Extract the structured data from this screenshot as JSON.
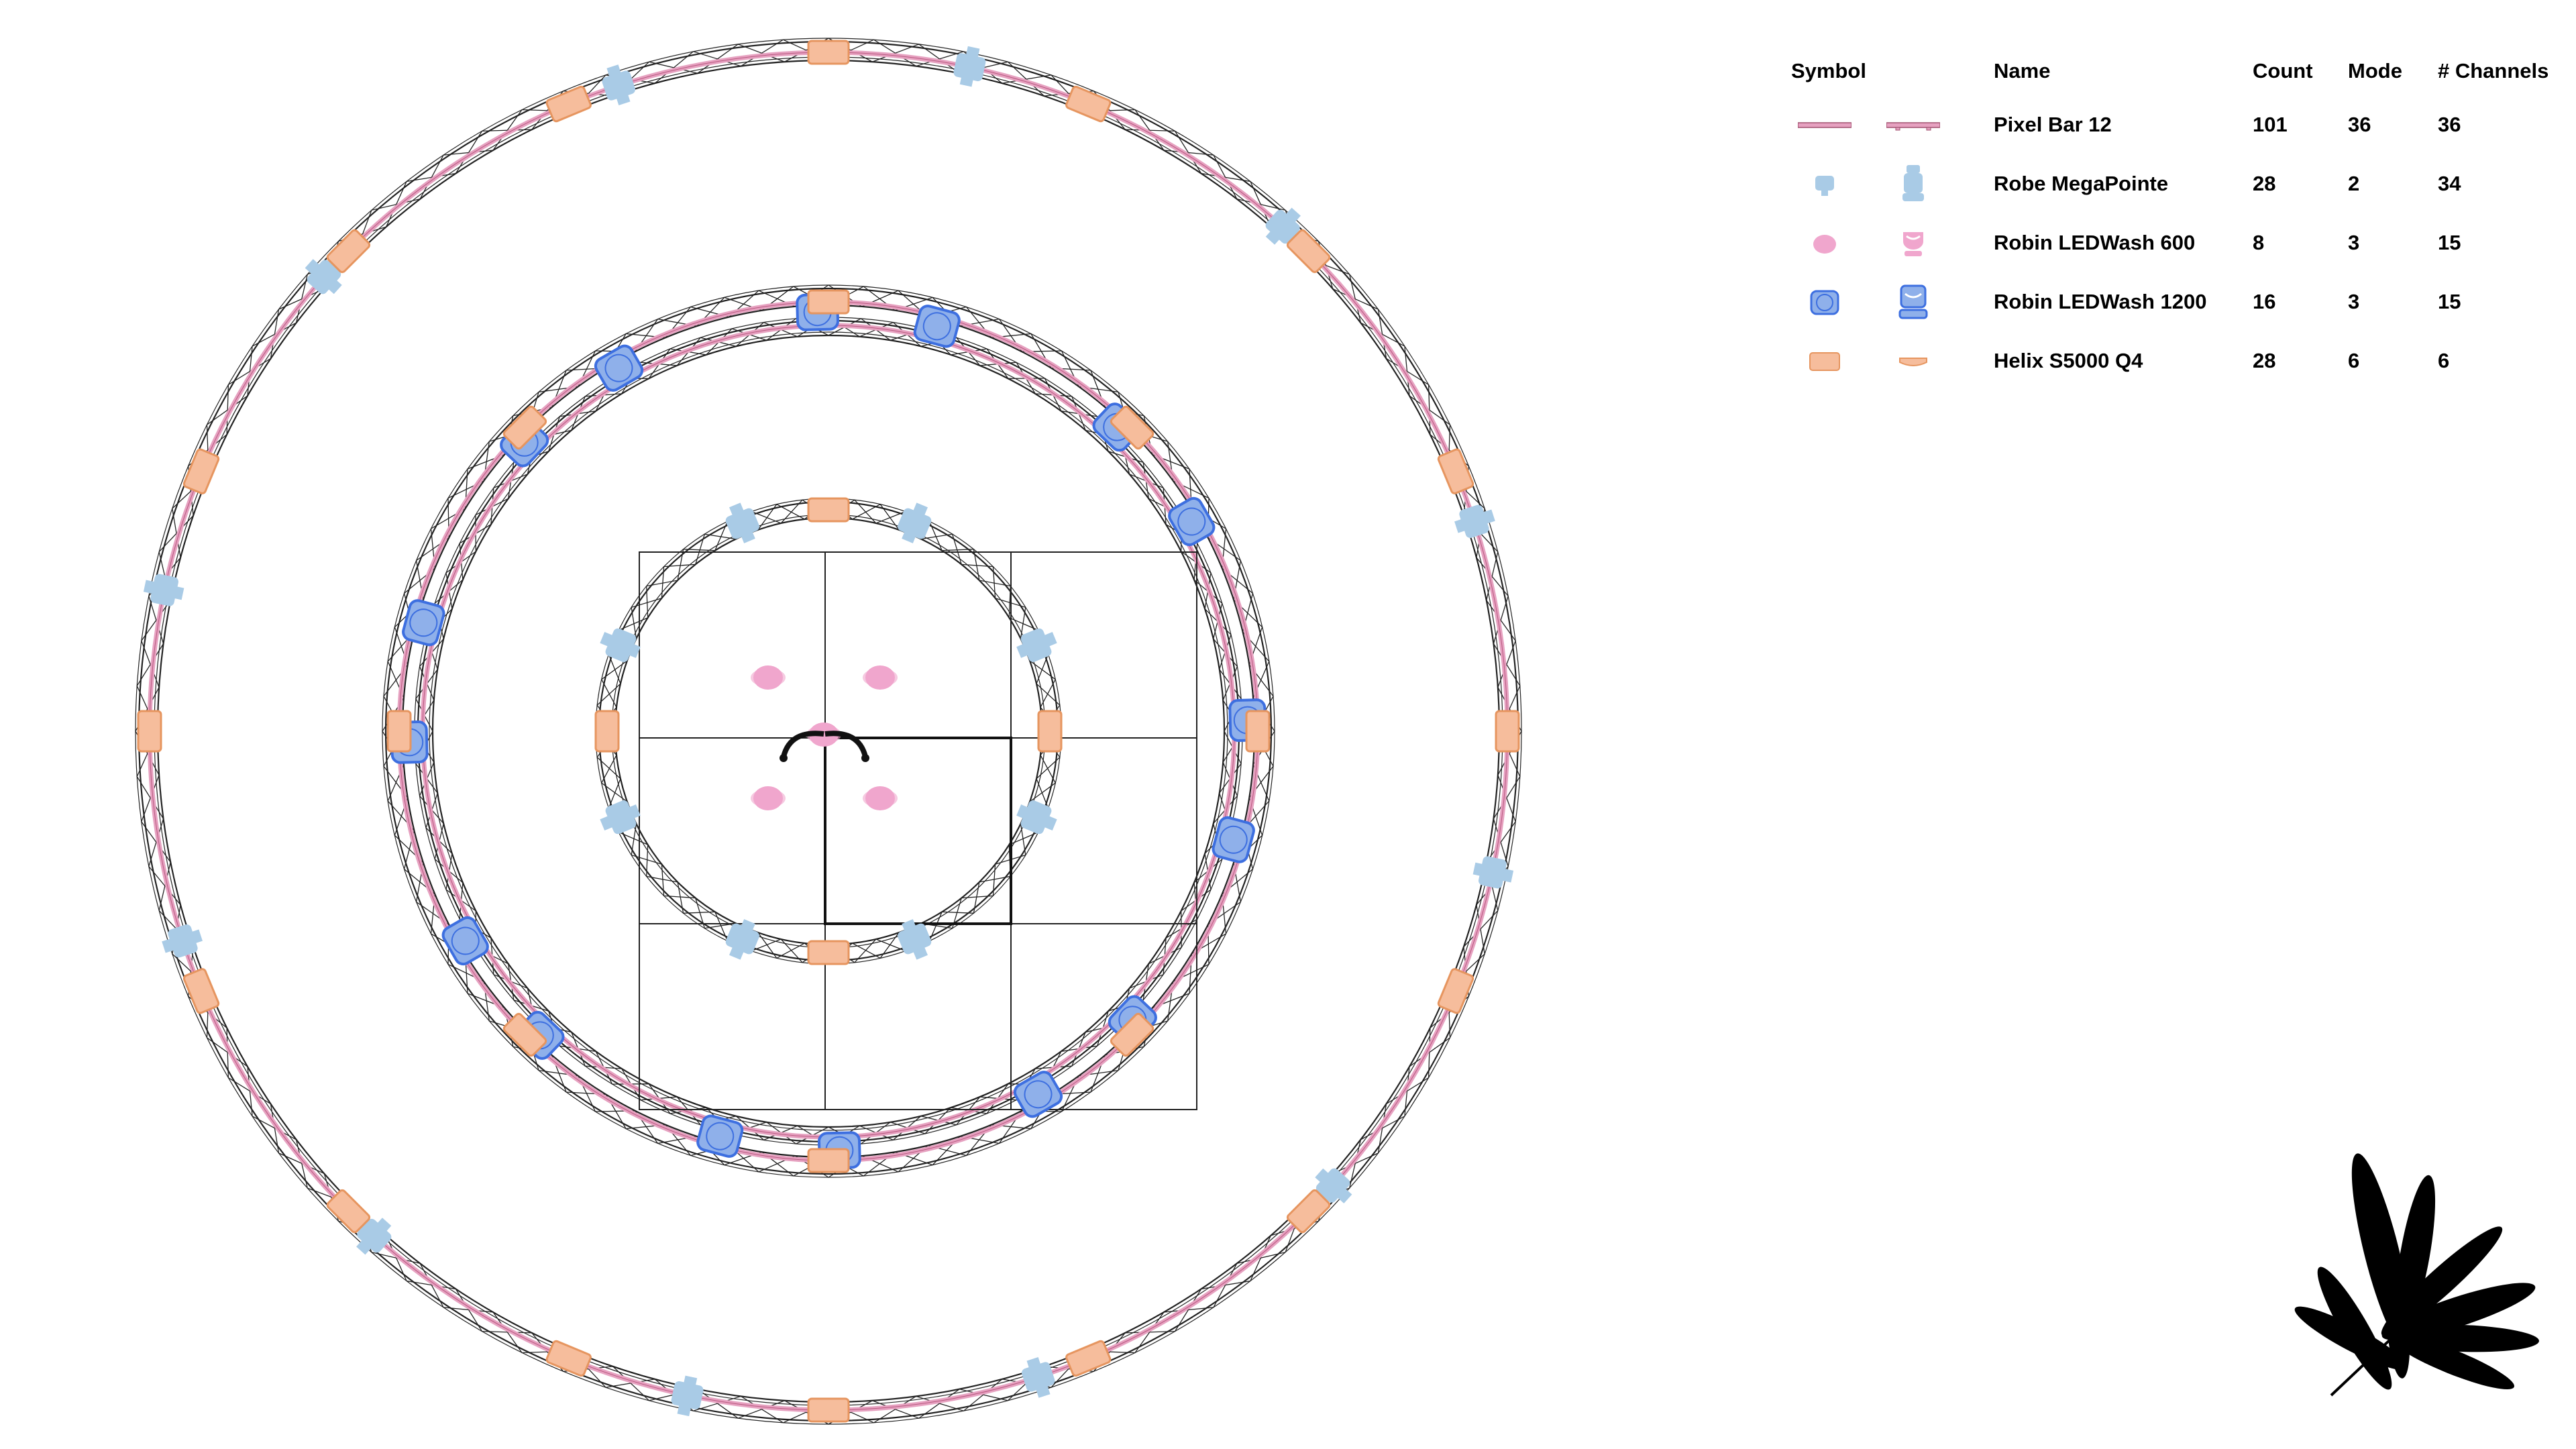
{
  "legend": {
    "headers": {
      "symbol": "Symbol",
      "name": "Name",
      "count": "Count",
      "mode": "Mode",
      "channels": "# Channels"
    },
    "rows": [
      {
        "name": "Pixel Bar 12",
        "count": "101",
        "mode": "36",
        "channels": "36",
        "symbol": "pixel-bar-icon"
      },
      {
        "name": "Robe MegaPointe",
        "count": "28",
        "mode": "2",
        "channels": "34",
        "symbol": "moving-head-spot-icon"
      },
      {
        "name": "Robin LEDWash 600",
        "count": "8",
        "mode": "3",
        "channels": "15",
        "symbol": "wash-600-icon"
      },
      {
        "name": "Robin LEDWash 1200",
        "count": "16",
        "mode": "3",
        "channels": "15",
        "symbol": "wash-1200-icon"
      },
      {
        "name": "Helix S5000 Q4",
        "count": "28",
        "mode": "6",
        "channels": "6",
        "symbol": "helix-strobe-icon"
      }
    ]
  },
  "colors": {
    "pixel_bar": "#e6a1c0",
    "megapointe": "#a9cbe6",
    "wash600": "#f0a6cd",
    "wash1200": "#8fb0ea",
    "wash1200_stroke": "#3d6fe0",
    "helix": "#f6bd9c",
    "helix_stroke": "#e6955f",
    "truss": "#222222",
    "logo": "#000000"
  },
  "logo": {
    "icon": "palm-leaf-logo-icon"
  }
}
